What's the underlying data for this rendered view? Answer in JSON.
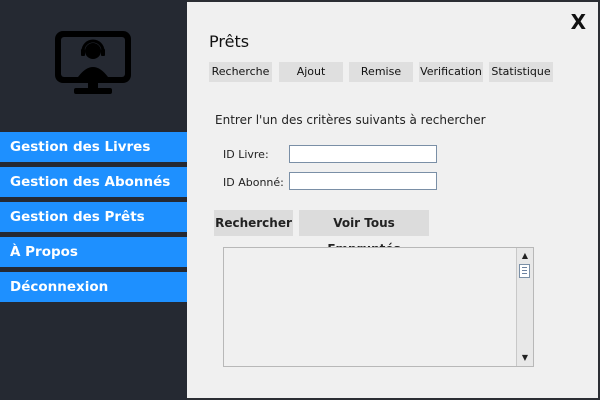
{
  "sidebar": {
    "logo_icon": "support-agent-monitor-icon",
    "items": [
      {
        "label": "Gestion des Livres"
      },
      {
        "label": "Gestion des Abonnés"
      },
      {
        "label": "Gestion des Prêts"
      },
      {
        "label": "À Propos"
      },
      {
        "label": "Déconnexion"
      }
    ],
    "accent_color": "#1e90ff"
  },
  "main": {
    "close_label": "X",
    "title": "Prêts",
    "tabs": [
      {
        "label": "Recherche"
      },
      {
        "label": "Ajout"
      },
      {
        "label": "Remise"
      },
      {
        "label": "Verification"
      },
      {
        "label": "Statistique"
      }
    ],
    "instruction": "Entrer l'un des critères suivants à rechercher",
    "fields": [
      {
        "label": "ID Livre:",
        "value": ""
      },
      {
        "label": "ID Abonné:",
        "value": ""
      }
    ],
    "buttons": {
      "search_label": "Rechercher",
      "view_all_label": "Voir Tous Empruntés"
    },
    "results": {
      "text": ""
    }
  }
}
